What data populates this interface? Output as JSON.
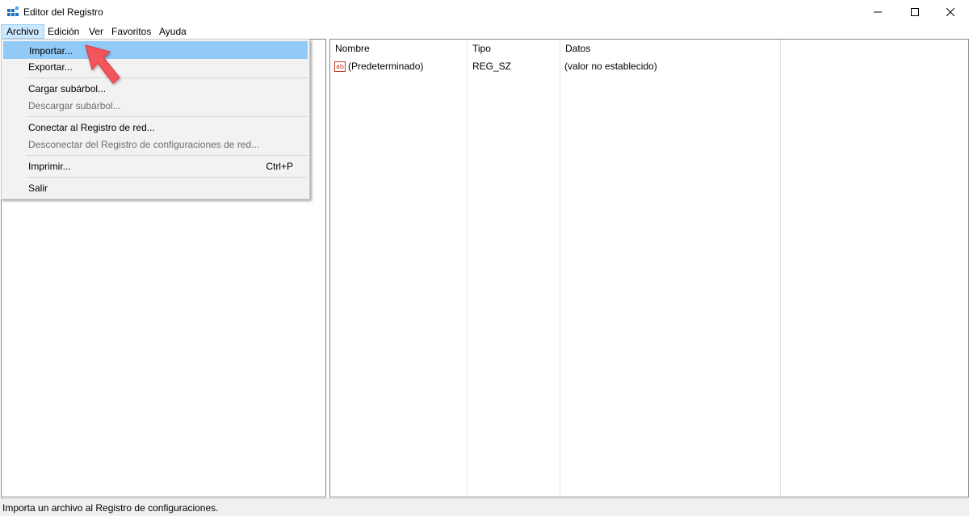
{
  "window": {
    "title": "Editor del Registro",
    "controls": [
      "minimize-icon",
      "maximize-icon",
      "close-icon"
    ]
  },
  "menubar": {
    "items": [
      "Archivo",
      "Edición",
      "Ver",
      "Favoritos",
      "Ayuda"
    ],
    "active": "Archivo"
  },
  "file_menu": {
    "items": [
      {
        "label": "Importar...",
        "enabled": true,
        "highlighted": true
      },
      {
        "label": "Exportar...",
        "enabled": true
      },
      {
        "label": "Cargar subárbol...",
        "enabled": true
      },
      {
        "label": "Descargar subárbol...",
        "enabled": false
      },
      {
        "label": "Conectar al Registro de red...",
        "enabled": true
      },
      {
        "label": "Desconectar del Registro de configuraciones de red...",
        "enabled": false
      },
      {
        "label": "Imprimir...",
        "shortcut": "Ctrl+P",
        "enabled": true
      },
      {
        "label": "Salir",
        "enabled": true
      }
    ]
  },
  "values_list": {
    "columns": [
      "Nombre",
      "Tipo",
      "Datos"
    ],
    "rows": [
      {
        "icon": "string-value-icon",
        "name": "(Predeterminado)",
        "type": "REG_SZ",
        "data": "(valor no establecido)"
      }
    ]
  },
  "statusbar": {
    "text": "Importa un archivo al Registro de configuraciones."
  },
  "colors": {
    "menu_highlight": "#91c9f7",
    "menubar_active": "#cce8ff",
    "annotation_arrow": "#f2545b"
  }
}
